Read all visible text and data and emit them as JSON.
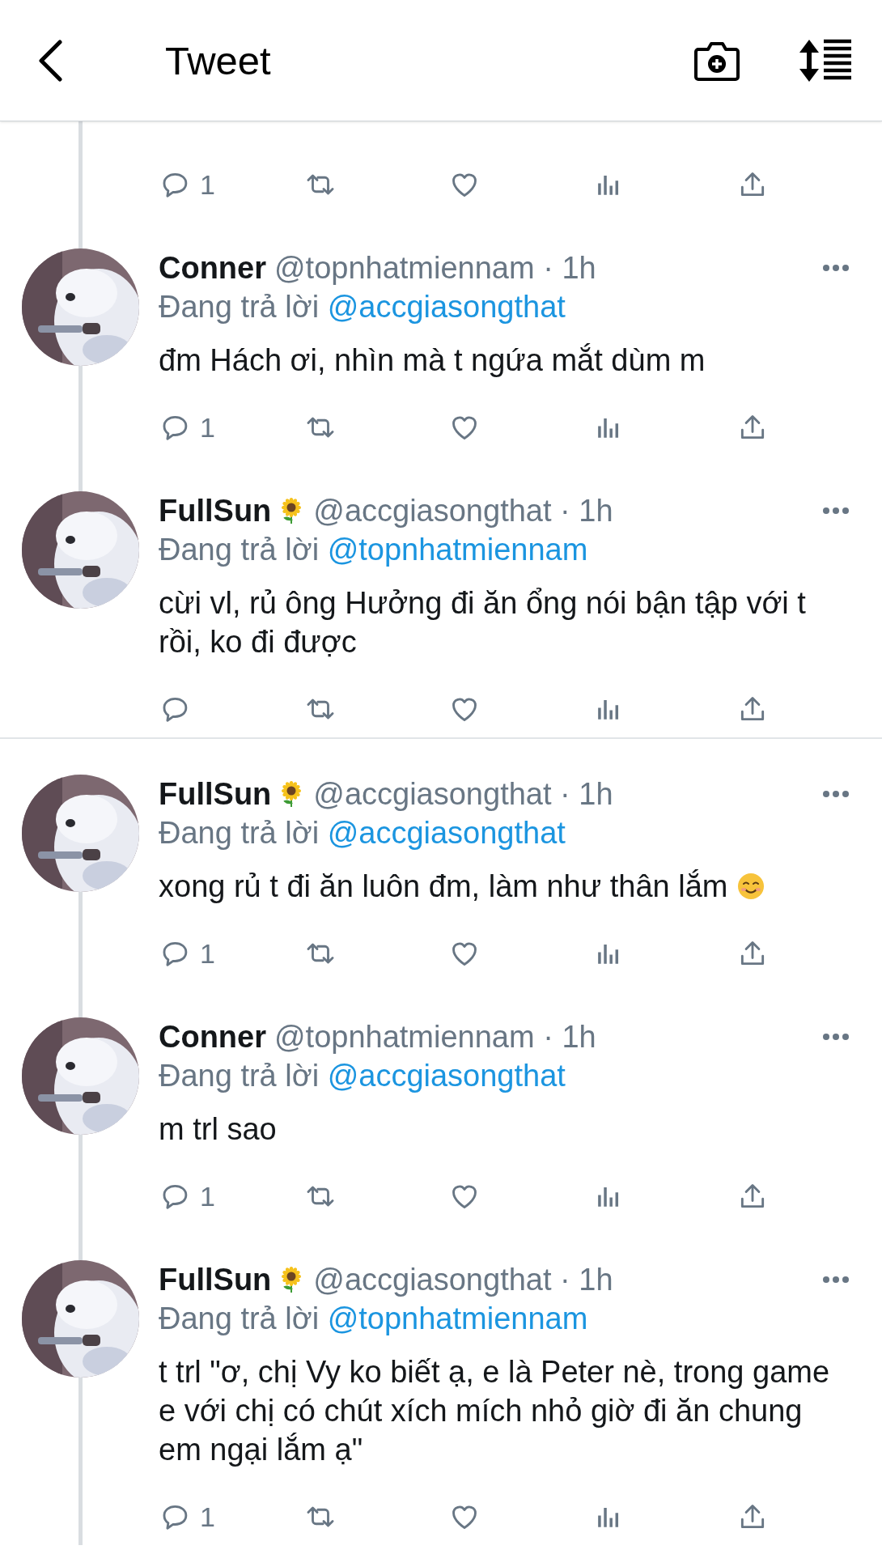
{
  "header": {
    "title": "Tweet"
  },
  "top_actions": {
    "reply_count": "1",
    "thread_line": true
  },
  "threads": [
    {
      "tweets": [
        {
          "name": "Conner",
          "name_emoji": false,
          "meta": "@topnhatmiennam · 1h",
          "reply_prefix": "Đang trả lời",
          "reply_to": "@accgiasongthat",
          "body": "đm Hách ơi, nhìn mà t ngứa mắt dùm m",
          "body_emoji": false,
          "reply_count": "1",
          "thread_above": true,
          "thread_below": true
        },
        {
          "name": "FullSun",
          "name_emoji": true,
          "meta": "@accgiasongthat · 1h",
          "reply_prefix": "Đang trả lời",
          "reply_to": "@topnhatmiennam",
          "body": "cừi vl, rủ ông Hưởng đi ăn ổng nói bận tập với t rồi, ko đi được",
          "body_emoji": false,
          "thread_above": true,
          "thread_below": false
        }
      ]
    },
    {
      "tweets": [
        {
          "name": "FullSun",
          "name_emoji": true,
          "meta": "@accgiasongthat · 1h",
          "reply_prefix": "Đang trả lời",
          "reply_to": "@accgiasongthat",
          "body": "xong rủ t đi ăn luôn đm, làm như thân lắm",
          "body_emoji": true,
          "reply_count": "1",
          "thread_above": false,
          "thread_below": true
        },
        {
          "name": "Conner",
          "name_emoji": false,
          "meta": "@topnhatmiennam · 1h",
          "reply_prefix": "Đang trả lời",
          "reply_to": "@accgiasongthat",
          "body": "m trl sao",
          "body_emoji": false,
          "reply_count": "1",
          "thread_above": true,
          "thread_below": true
        },
        {
          "name": "FullSun",
          "name_emoji": true,
          "meta": "@accgiasongthat · 1h",
          "reply_prefix": "Đang trả lời",
          "reply_to": "@topnhatmiennam",
          "body": "t trl \"ơ, chị Vy ko biết ạ, e là Peter nè, trong game e với chị có chút xích mích nhỏ giờ đi ăn chung em ngại lắm ạ\"",
          "body_emoji": false,
          "reply_count": "1",
          "thread_above": true,
          "thread_below": true
        }
      ]
    }
  ]
}
